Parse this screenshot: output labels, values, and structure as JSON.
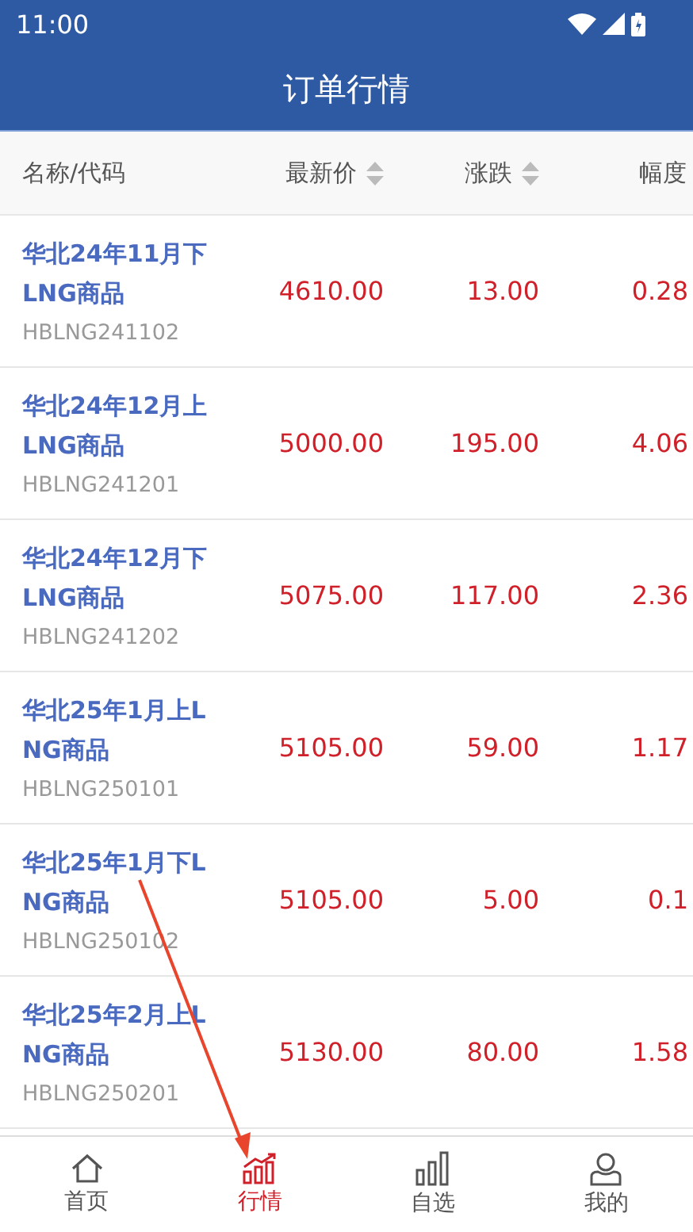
{
  "status_bar": {
    "time": "11:00"
  },
  "title": "订单行情",
  "columns": [
    {
      "label": "名称/代码",
      "sortable": false
    },
    {
      "label": "最新价",
      "sortable": true
    },
    {
      "label": "涨跌",
      "sortable": true
    },
    {
      "label": "幅度",
      "sortable": false
    }
  ],
  "rows": [
    {
      "name": "华北24年11月下LNG商品",
      "code": "HBLNG241102",
      "price": "4610.00",
      "change": "13.00",
      "pct": "0.28"
    },
    {
      "name": "华北24年12月上LNG商品",
      "code": "HBLNG241201",
      "price": "5000.00",
      "change": "195.00",
      "pct": "4.06"
    },
    {
      "name": "华北24年12月下LNG商品",
      "code": "HBLNG241202",
      "price": "5075.00",
      "change": "117.00",
      "pct": "2.36"
    },
    {
      "name": "华北25年1月上LNG商品",
      "code": "HBLNG250101",
      "price": "5105.00",
      "change": "59.00",
      "pct": "1.17"
    },
    {
      "name": "华北25年1月下LNG商品",
      "code": "HBLNG250102",
      "price": "5105.00",
      "change": "5.00",
      "pct": "0.1"
    },
    {
      "name": "华北25年2月上LNG商品",
      "code": "HBLNG250201",
      "price": "5130.00",
      "change": "80.00",
      "pct": "1.58"
    }
  ],
  "tabs": [
    {
      "label": "首页",
      "kind": "home",
      "selected": false
    },
    {
      "label": "行情",
      "kind": "market",
      "selected": true
    },
    {
      "label": "自选",
      "kind": "watchlist",
      "selected": false
    },
    {
      "label": "我的",
      "kind": "profile",
      "selected": false
    }
  ]
}
